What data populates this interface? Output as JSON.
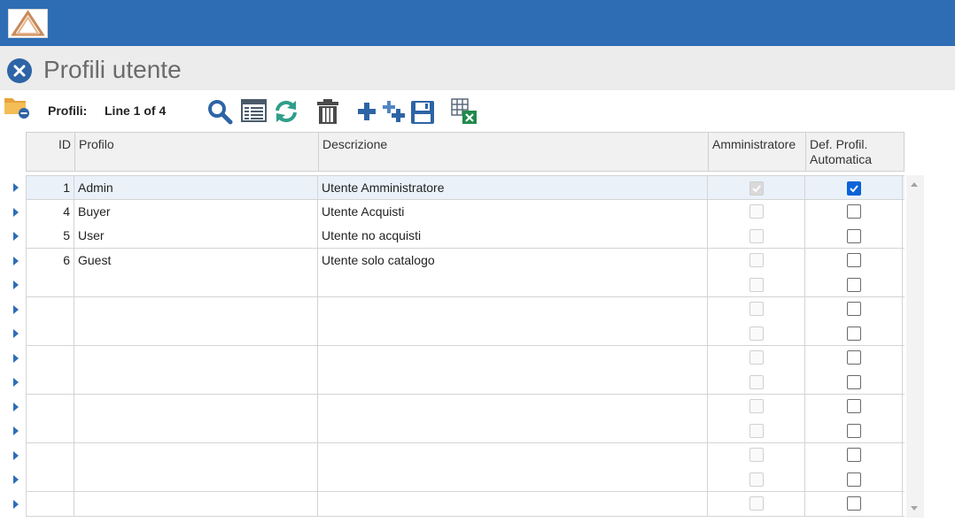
{
  "app": {
    "logo_icon": "triangle-logo-icon",
    "brand_color": "#2e6db4"
  },
  "header": {
    "title": "Profili utente",
    "close_icon": "close-circle-icon"
  },
  "toolbar": {
    "folder_icon": "folder-minus-icon",
    "profili_label": "Profili:",
    "line_label": "Line 1 of 4",
    "icons": [
      "search-icon",
      "list-view-icon",
      "refresh-icon",
      "delete-icon",
      "add-icon",
      "add-multiple-icon",
      "save-icon",
      "export-excel-icon"
    ]
  },
  "grid": {
    "columns": {
      "id": "ID",
      "profilo": "Profilo",
      "descrizione": "Descrizione",
      "amministratore": "Amministratore",
      "def_profil": "Def. Profil. Automatica"
    },
    "rows": [
      {
        "id": "1",
        "profilo": "Admin",
        "descrizione": "Utente Amministratore",
        "amministratore": true,
        "def_profil": true
      },
      {
        "id": "4",
        "profilo": "Buyer",
        "descrizione": "Utente Acquisti",
        "amministratore": false,
        "def_profil": false
      },
      {
        "id": "5",
        "profilo": "User",
        "descrizione": "Utente no acquisti",
        "amministratore": false,
        "def_profil": false
      },
      {
        "id": "6",
        "profilo": "Guest",
        "descrizione": "Utente solo catalogo",
        "amministratore": false,
        "def_profil": false
      },
      {
        "id": "",
        "profilo": "",
        "descrizione": "",
        "amministratore": false,
        "def_profil": false
      },
      {
        "id": "",
        "profilo": "",
        "descrizione": "",
        "amministratore": false,
        "def_profil": false
      },
      {
        "id": "",
        "profilo": "",
        "descrizione": "",
        "amministratore": false,
        "def_profil": false
      },
      {
        "id": "",
        "profilo": "",
        "descrizione": "",
        "amministratore": false,
        "def_profil": false
      },
      {
        "id": "",
        "profilo": "",
        "descrizione": "",
        "amministratore": false,
        "def_profil": false
      },
      {
        "id": "",
        "profilo": "",
        "descrizione": "",
        "amministratore": false,
        "def_profil": false
      },
      {
        "id": "",
        "profilo": "",
        "descrizione": "",
        "amministratore": false,
        "def_profil": false
      },
      {
        "id": "",
        "profilo": "",
        "descrizione": "",
        "amministratore": false,
        "def_profil": false
      },
      {
        "id": "",
        "profilo": "",
        "descrizione": "",
        "amministratore": false,
        "def_profil": false
      },
      {
        "id": "",
        "profilo": "",
        "descrizione": "",
        "amministratore": false,
        "def_profil": false
      }
    ]
  }
}
